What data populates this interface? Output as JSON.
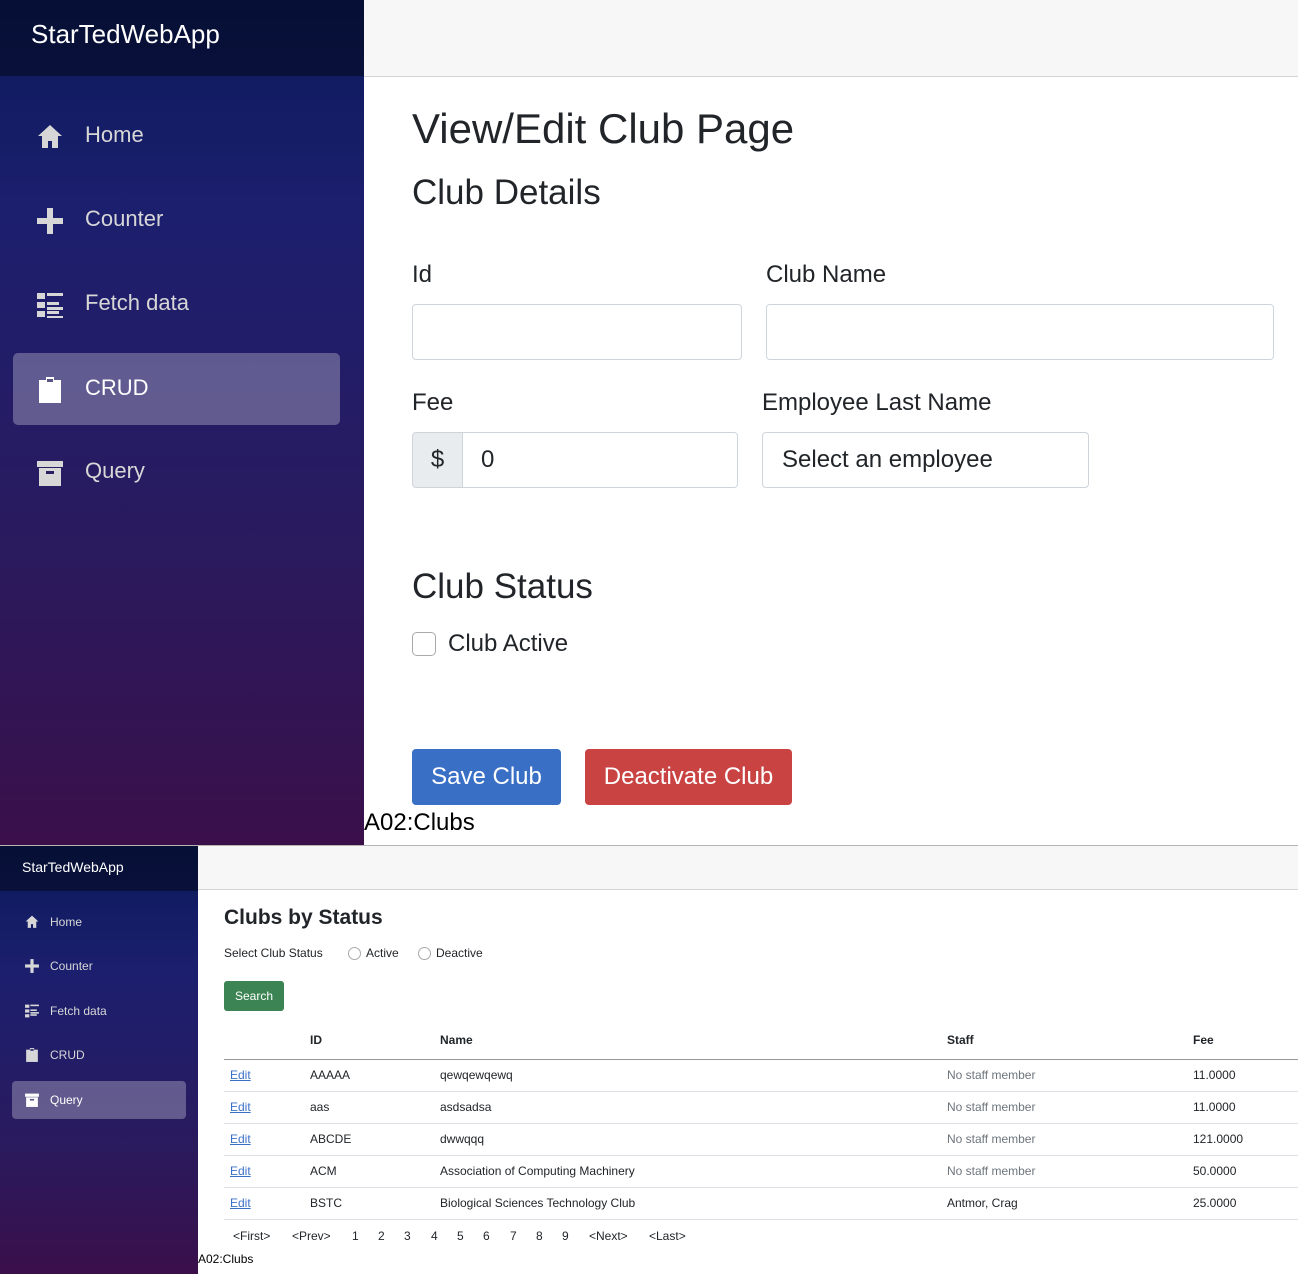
{
  "top": {
    "brand": "StarTedWebApp",
    "nav": [
      "Home",
      "Counter",
      "Fetch data",
      "CRUD",
      "Query"
    ],
    "page_title": "View/Edit Club Page",
    "section_details": "Club Details",
    "labels": {
      "id": "Id",
      "club_name": "Club Name",
      "fee": "Fee",
      "employee": "Employee Last Name"
    },
    "values": {
      "id": "",
      "club_name": "",
      "fee": "0",
      "currency": "$",
      "employee": "Select an employee"
    },
    "section_status": "Club Status",
    "club_active_label": "Club Active",
    "club_active_checked": false,
    "save_button": "Save Club",
    "deactivate_button": "Deactivate Club",
    "caption": "A02:Clubs"
  },
  "bottom": {
    "brand": "StarTedWebApp",
    "nav": [
      "Home",
      "Counter",
      "Fetch data",
      "CRUD",
      "Query"
    ],
    "title": "Clubs by Status",
    "select_status_label": "Select Club Status",
    "radio_active": "Active",
    "radio_deactive": "Deactive",
    "search_button": "Search",
    "table": {
      "columns": [
        "",
        "ID",
        "Name",
        "Staff",
        "Fee"
      ],
      "rows": [
        {
          "edit": "Edit",
          "id": "AAAAA",
          "name": "qewqewqewq",
          "staff": "No staff member",
          "fee": "11.0000"
        },
        {
          "edit": "Edit",
          "id": "aas",
          "name": "asdsadsa",
          "staff": "No staff member",
          "fee": "11.0000"
        },
        {
          "edit": "Edit",
          "id": "ABCDE",
          "name": "dwwqqq",
          "staff": "No staff member",
          "fee": "121.0000"
        },
        {
          "edit": "Edit",
          "id": "ACM",
          "name": "Association of Computing Machinery",
          "staff": "No staff member",
          "fee": "50.0000"
        },
        {
          "edit": "Edit",
          "id": "BSTC",
          "name": "Biological Sciences Technology Club",
          "staff": "Antmor, Crag",
          "fee": "25.0000"
        }
      ]
    },
    "pager": [
      "<First>",
      "<Prev>",
      "1",
      "2",
      "3",
      "4",
      "5",
      "6",
      "7",
      "8",
      "9",
      "<Next>",
      "<Last>"
    ],
    "caption": "A02:Clubs"
  }
}
